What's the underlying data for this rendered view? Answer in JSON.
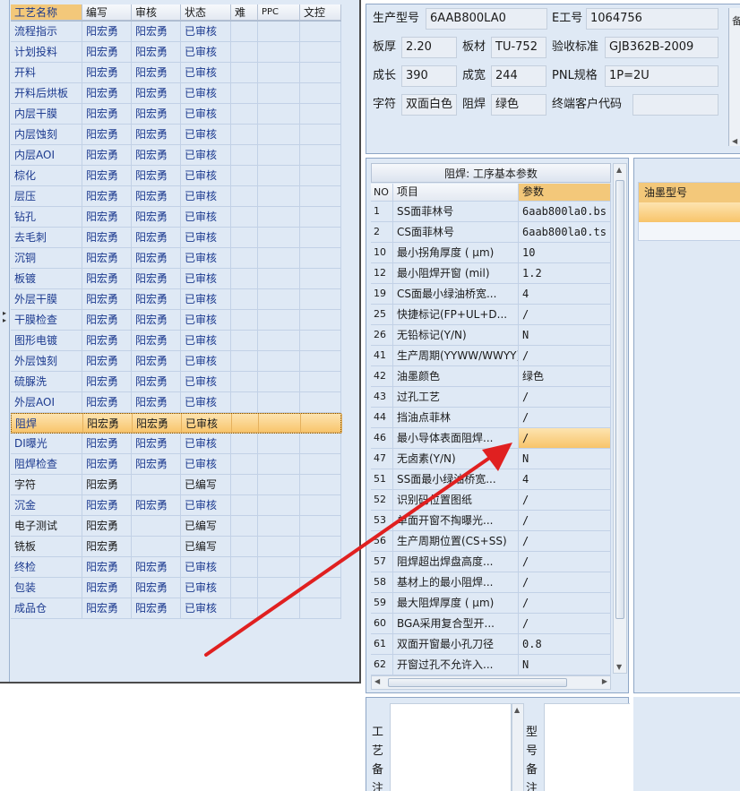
{
  "process_grid": {
    "headers": [
      "工艺名称",
      "编写",
      "审核",
      "状态",
      "难",
      "PPC",
      "文控"
    ],
    "rows": [
      {
        "name": "流程指示",
        "writer": "阳宏勇",
        "reviewer": "阳宏勇",
        "status": "已审核"
      },
      {
        "name": "计划投料",
        "writer": "阳宏勇",
        "reviewer": "阳宏勇",
        "status": "已审核"
      },
      {
        "name": "开料",
        "writer": "阳宏勇",
        "reviewer": "阳宏勇",
        "status": "已审核"
      },
      {
        "name": "开料后烘板",
        "writer": "阳宏勇",
        "reviewer": "阳宏勇",
        "status": "已审核"
      },
      {
        "name": "内层干膜",
        "writer": "阳宏勇",
        "reviewer": "阳宏勇",
        "status": "已审核"
      },
      {
        "name": "内层蚀刻",
        "writer": "阳宏勇",
        "reviewer": "阳宏勇",
        "status": "已审核"
      },
      {
        "name": "内层AOI",
        "writer": "阳宏勇",
        "reviewer": "阳宏勇",
        "status": "已审核"
      },
      {
        "name": "棕化",
        "writer": "阳宏勇",
        "reviewer": "阳宏勇",
        "status": "已审核"
      },
      {
        "name": "层压",
        "writer": "阳宏勇",
        "reviewer": "阳宏勇",
        "status": "已审核"
      },
      {
        "name": "钻孔",
        "writer": "阳宏勇",
        "reviewer": "阳宏勇",
        "status": "已审核"
      },
      {
        "name": "去毛刺",
        "writer": "阳宏勇",
        "reviewer": "阳宏勇",
        "status": "已审核"
      },
      {
        "name": "沉铜",
        "writer": "阳宏勇",
        "reviewer": "阳宏勇",
        "status": "已审核"
      },
      {
        "name": "板镀",
        "writer": "阳宏勇",
        "reviewer": "阳宏勇",
        "status": "已审核"
      },
      {
        "name": "外层干膜",
        "writer": "阳宏勇",
        "reviewer": "阳宏勇",
        "status": "已审核"
      },
      {
        "name": "干膜检查",
        "writer": "阳宏勇",
        "reviewer": "阳宏勇",
        "status": "已审核"
      },
      {
        "name": "图形电镀",
        "writer": "阳宏勇",
        "reviewer": "阳宏勇",
        "status": "已审核"
      },
      {
        "name": "外层蚀刻",
        "writer": "阳宏勇",
        "reviewer": "阳宏勇",
        "status": "已审核"
      },
      {
        "name": "硫脲洗",
        "writer": "阳宏勇",
        "reviewer": "阳宏勇",
        "status": "已审核"
      },
      {
        "name": "外层AOI",
        "writer": "阳宏勇",
        "reviewer": "阳宏勇",
        "status": "已审核"
      },
      {
        "name": "阻焊",
        "writer": "阳宏勇",
        "reviewer": "阳宏勇",
        "status": "已审核",
        "selected": true
      },
      {
        "name": "DI曝光",
        "writer": "阳宏勇",
        "reviewer": "阳宏勇",
        "status": "已审核"
      },
      {
        "name": "阻焊检查",
        "writer": "阳宏勇",
        "reviewer": "阳宏勇",
        "status": "已审核"
      },
      {
        "name": "字符",
        "writer": "阳宏勇",
        "reviewer": "",
        "status": "已编写",
        "plain": true
      },
      {
        "name": "沉金",
        "writer": "阳宏勇",
        "reviewer": "阳宏勇",
        "status": "已审核"
      },
      {
        "name": "电子测试",
        "writer": "阳宏勇",
        "reviewer": "",
        "status": "已编写",
        "plain": true
      },
      {
        "name": "铣板",
        "writer": "阳宏勇",
        "reviewer": "",
        "status": "已编写",
        "plain": true
      },
      {
        "name": "终检",
        "writer": "阳宏勇",
        "reviewer": "阳宏勇",
        "status": "已审核"
      },
      {
        "name": "包装",
        "writer": "阳宏勇",
        "reviewer": "阳宏勇",
        "status": "已审核"
      },
      {
        "name": "成品仓",
        "writer": "阳宏勇",
        "reviewer": "阳宏勇",
        "status": "已审核"
      }
    ]
  },
  "info": {
    "model_label": "生产型号",
    "model_value": "6AAB800LA0",
    "e_label": "E工号",
    "e_value": "1064756",
    "thickness_label": "板厚",
    "thickness_value": "2.20",
    "material_label": "板材",
    "material_value": "TU-752",
    "standard_label": "验收标准",
    "standard_value": "GJB362B-2009",
    "length_label": "成长",
    "length_value": "390",
    "width_label": "成宽",
    "width_value": "244",
    "pnl_label": "PNL规格",
    "pnl_value": "1P=2U",
    "char_label": "字符",
    "char_value": "双面白色",
    "mask_label": "阻焊",
    "mask_value": "绿色",
    "customer_label": "终端客户代码",
    "customer_value": "",
    "side_caption": "备"
  },
  "params": {
    "title": "阻焊: 工序基本参数",
    "headers": [
      "NO",
      "项目",
      "参数"
    ],
    "rows": [
      {
        "no": "1",
        "item": "SS面菲林号",
        "value": "6aab800la0.bs"
      },
      {
        "no": "2",
        "item": "CS面菲林号",
        "value": "6aab800la0.ts"
      },
      {
        "no": "10",
        "item": "最小拐角厚度 ( μm)",
        "value": "10"
      },
      {
        "no": "12",
        "item": "最小阻焊开窗 (mil)",
        "value": "1.2"
      },
      {
        "no": "19",
        "item": "CS面最小绿油桥宽...",
        "value": "4"
      },
      {
        "no": "25",
        "item": "快捷标记(FP+UL+D...",
        "value": "/"
      },
      {
        "no": "26",
        "item": "无铅标记(Y/N)",
        "value": "N"
      },
      {
        "no": "41",
        "item": "生产周期(YYWW/WWYY)",
        "value": "/"
      },
      {
        "no": "42",
        "item": "油墨颜色",
        "value": "绿色"
      },
      {
        "no": "43",
        "item": "过孔工艺",
        "value": "/"
      },
      {
        "no": "44",
        "item": "挡油点菲林",
        "value": "/"
      },
      {
        "no": "46",
        "item": "最小导体表面阻焊...",
        "value": "/",
        "selected": true
      },
      {
        "no": "47",
        "item": "无卤素(Y/N)",
        "value": "N"
      },
      {
        "no": "51",
        "item": "SS面最小绿油桥宽...",
        "value": "4"
      },
      {
        "no": "52",
        "item": "识别码位置图纸",
        "value": "/"
      },
      {
        "no": "53",
        "item": "单面开窗不掏曝光...",
        "value": "/"
      },
      {
        "no": "56",
        "item": "生产周期位置(CS+SS)",
        "value": "/"
      },
      {
        "no": "57",
        "item": "阻焊超出焊盘高度...",
        "value": "/"
      },
      {
        "no": "58",
        "item": "基材上的最小阻焊...",
        "value": "/"
      },
      {
        "no": "59",
        "item": "最大阻焊厚度 ( μm)",
        "value": "/"
      },
      {
        "no": "60",
        "item": "BGA采用复合型开...",
        "value": "/"
      },
      {
        "no": "61",
        "item": "双面开窗最小孔刀径",
        "value": "0.8"
      },
      {
        "no": "62",
        "item": "开窗过孔不允许入...",
        "value": "N"
      }
    ]
  },
  "ink": {
    "header": "油墨型号"
  },
  "remarks": {
    "process_label": "工艺备注",
    "model_label": "型号备注"
  },
  "colors": {
    "accent": "#f3c87a",
    "panel": "#dfe9f5",
    "link_text": "#1c3a8f",
    "arrow": "#e02020"
  }
}
